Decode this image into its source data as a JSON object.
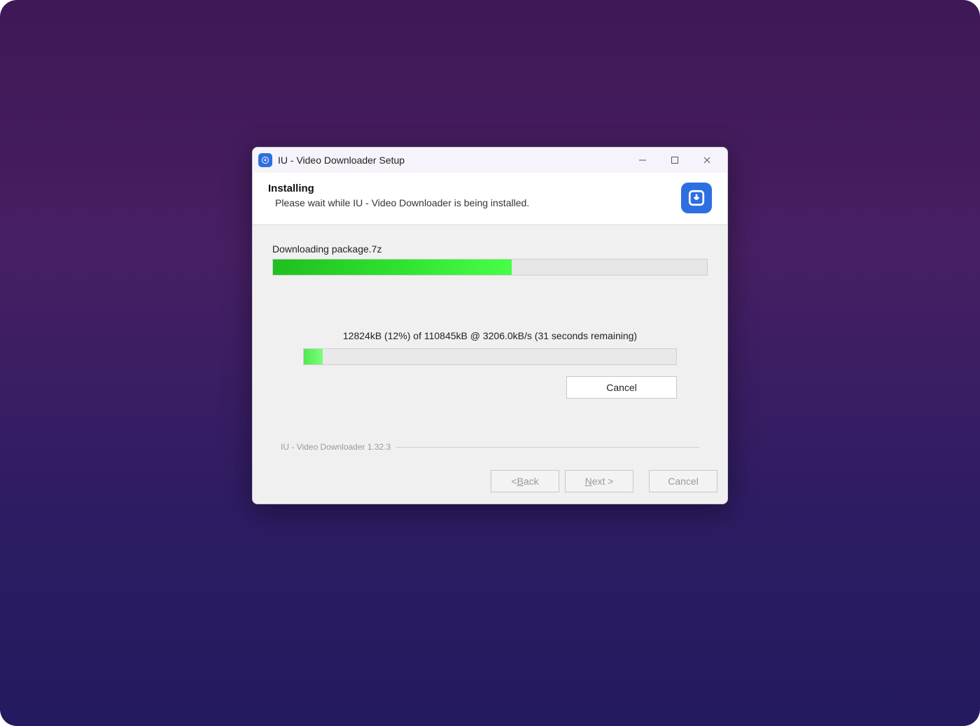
{
  "window": {
    "title": "IU - Video Downloader Setup"
  },
  "header": {
    "title": "Installing",
    "subtitle": "Please wait while IU - Video Downloader is being installed."
  },
  "progress": {
    "task_label": "Downloading package.7z",
    "main_percent": 55,
    "download_status": "12824kB (12%) of 110845kB @ 3206.0kB/s (31 seconds remaining)",
    "download_percent": 5,
    "cancel_label": "Cancel"
  },
  "footer": {
    "brand": "IU - Video Downloader 1.32.3",
    "back_prefix": "< ",
    "back_u": "B",
    "back_rest": "ack",
    "next_u": "N",
    "next_rest": "ext >",
    "cancel": "Cancel"
  }
}
